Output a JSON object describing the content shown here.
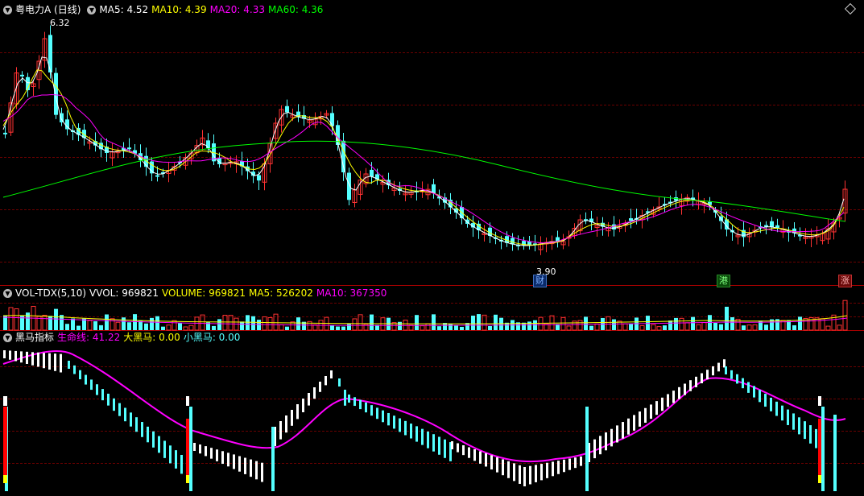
{
  "main": {
    "title": "粤电力A (日线)",
    "ma5_label": "MA5: 4.52",
    "ma10_label": "MA10: 4.39",
    "ma20_label": "MA20: 4.33",
    "ma60_label": "MA60: 4.36",
    "high_label": "6.32",
    "low_label": "3.90",
    "tag_cai": "财",
    "tag_gang": "港",
    "tag_zhang": "涨",
    "colors": {
      "ma5": "#ffffff",
      "ma10": "#ffff00",
      "ma20": "#ff00ff",
      "ma60": "#00ff00",
      "up": "#ff3232",
      "down": "#54ffff"
    }
  },
  "volume": {
    "title": "VOL-TDX(5,10)",
    "vvol_label": "VVOL: 969821",
    "volume_label": "VOLUME: 969821",
    "ma5_label": "MA5: 526202",
    "ma10_label": "MA10: 367350"
  },
  "indicator": {
    "title": "黑马指标",
    "life_label": "生命线: 41.22",
    "big_label": "大黑马: 0.00",
    "small_label": "小黑马: 0.00"
  },
  "icons": [
    "collapse-circle-icon",
    "diamond-icon"
  ]
}
